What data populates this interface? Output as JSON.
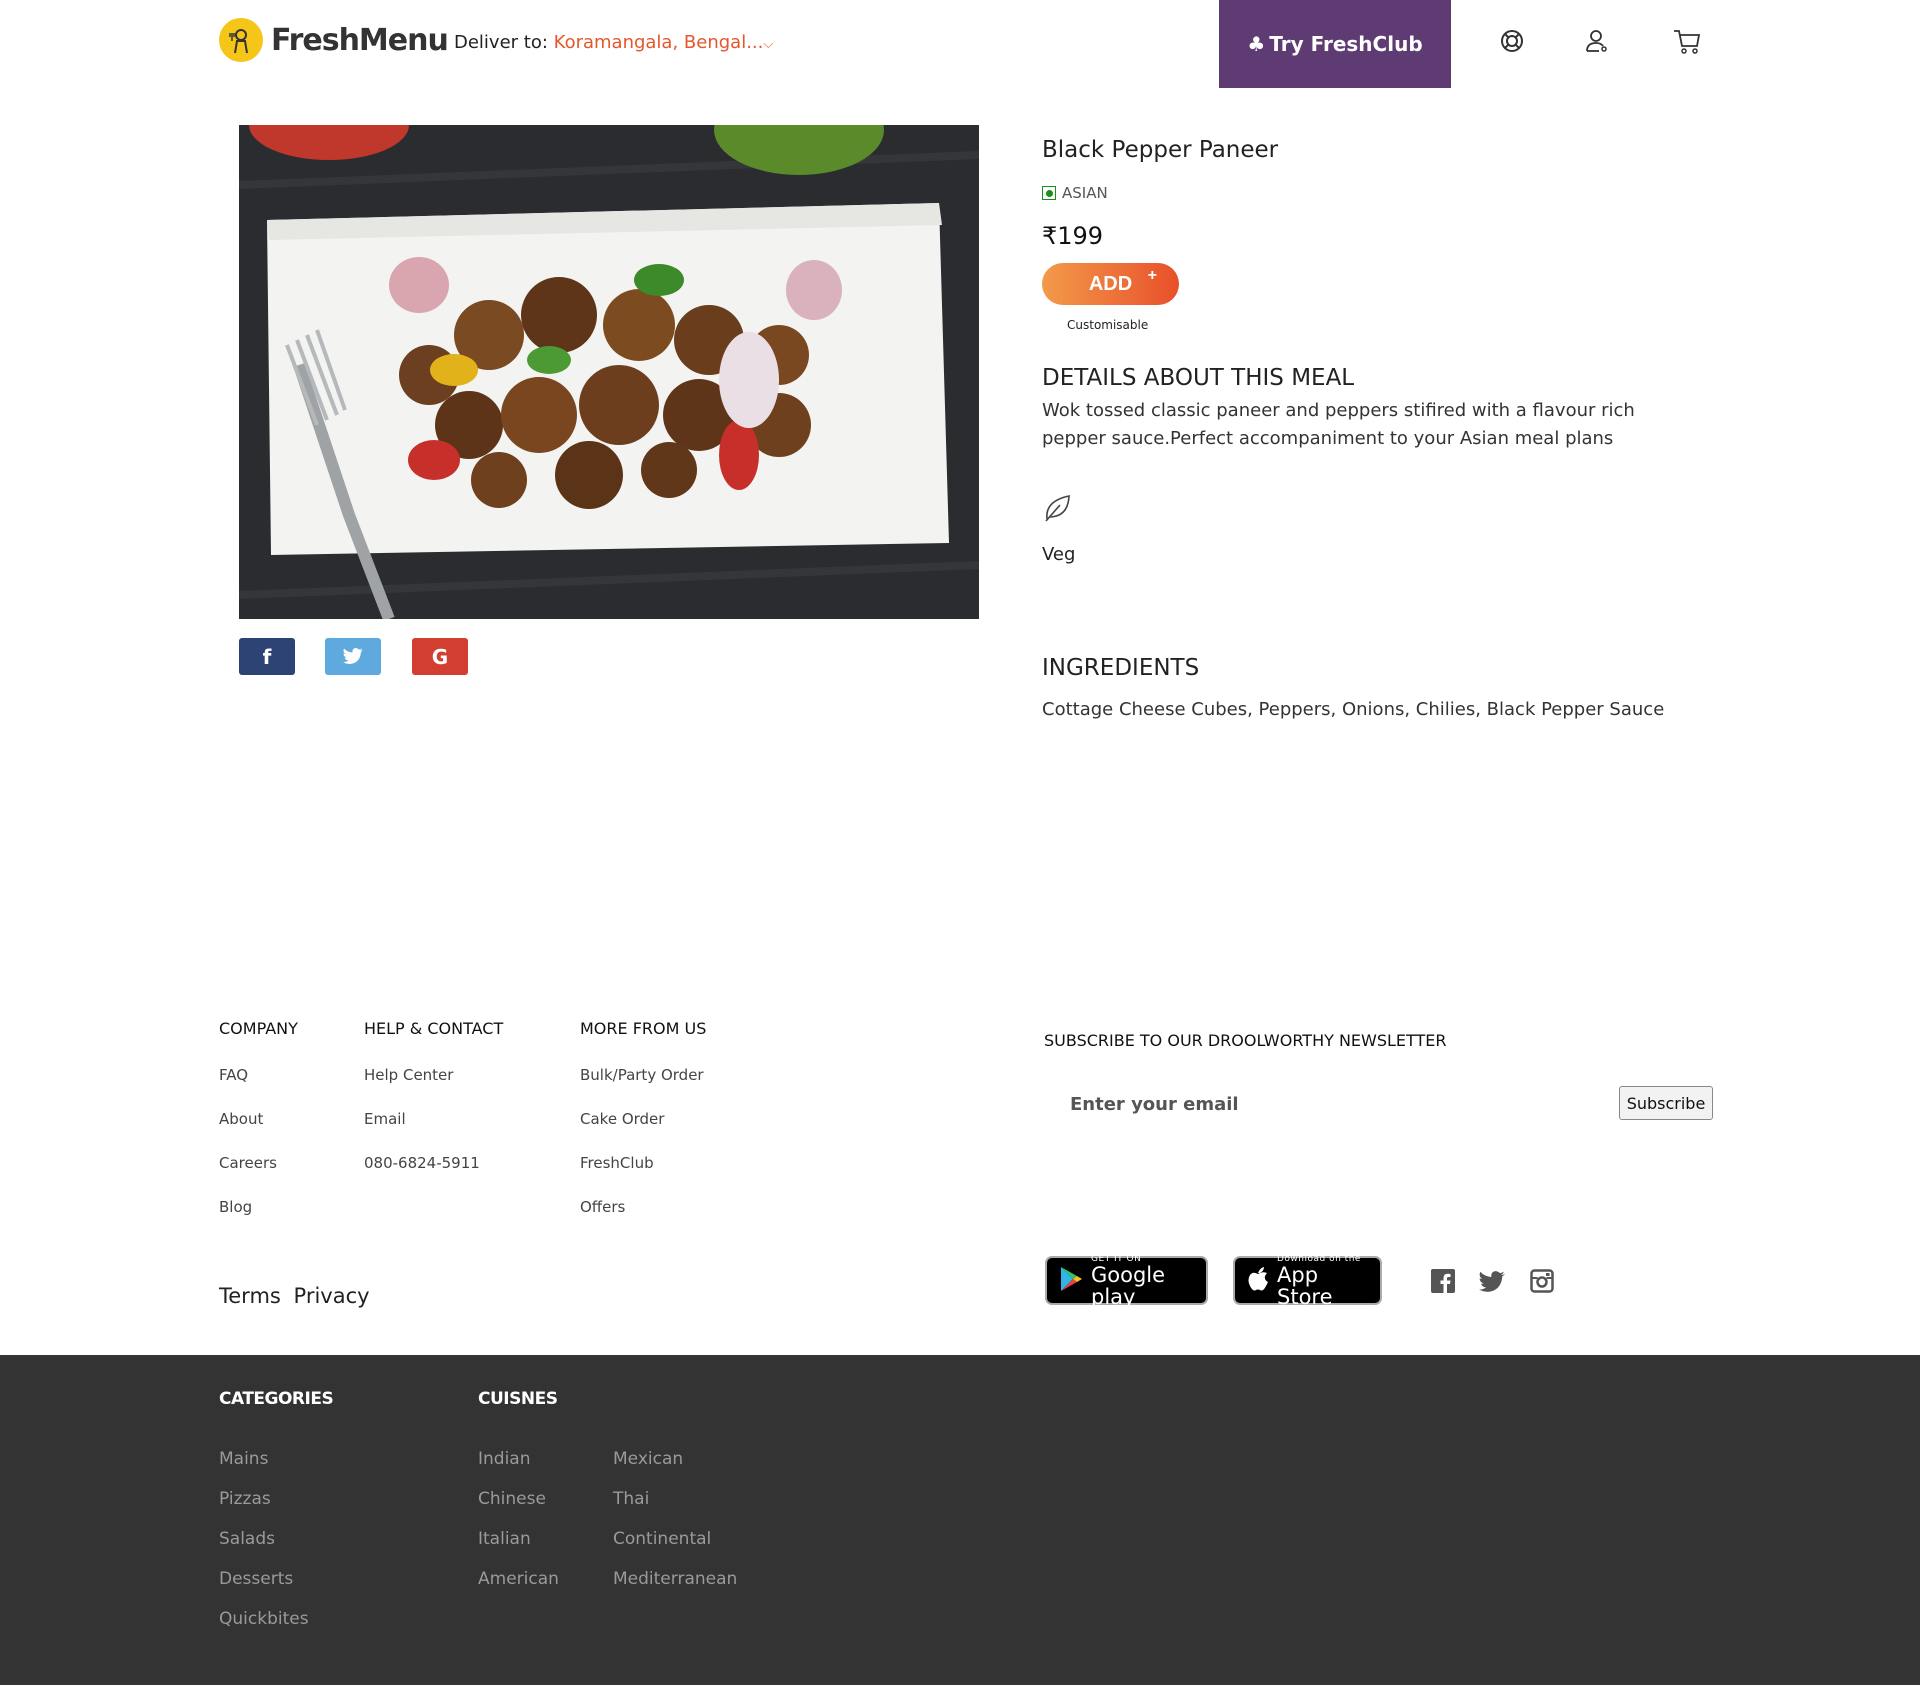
{
  "header": {
    "logo_text": "FreshMenu",
    "deliver_label": "Deliver to:",
    "deliver_location": "Koramangala, Bengal...",
    "freshclub_label": "Try FreshClub",
    "brand_color": "#5e3b72",
    "accent_color": "#e5562a"
  },
  "product": {
    "title": "Black Pepper Paneer",
    "cuisine": "ASIAN",
    "price": "₹199",
    "add_label": "ADD",
    "add_plus": "+",
    "customisable": "Customisable",
    "details_heading": "DETAILS ABOUT THIS MEAL",
    "details_text": "Wok tossed classic paneer and peppers stifired with a flavour rich pepper sauce.Perfect accompaniment to your Asian meal plans",
    "veg_label": "Veg",
    "ingredients_heading": "INGREDIENTS",
    "ingredients_text": "Cottage Cheese Cubes, Peppers, Onions, Chilies, Black Pepper Sauce",
    "share": [
      {
        "icon": "facebook-icon",
        "glyph": "f",
        "color": "#2d4373"
      },
      {
        "icon": "twitter-icon",
        "glyph": "🐦",
        "color": "#5ea9dd"
      },
      {
        "icon": "google-icon",
        "glyph": "G",
        "color": "#d23f31"
      }
    ]
  },
  "footer": {
    "company": {
      "heading": "COMPANY",
      "links": [
        "FAQ",
        "About",
        "Careers",
        "Blog"
      ]
    },
    "help": {
      "heading": "HELP & CONTACT",
      "links": [
        "Help Center",
        "Email",
        "080-6824-5911"
      ]
    },
    "more": {
      "heading": "MORE FROM US",
      "links": [
        "Bulk/Party Order",
        "Cake Order",
        "FreshClub",
        "Offers"
      ]
    },
    "terms": "Terms",
    "privacy": "Privacy",
    "newsletter": {
      "heading": "SUBSCRIBE TO OUR DROOLWORTHY NEWSLETTER",
      "placeholder": "Enter your email",
      "button": "Subscribe"
    },
    "google_play": {
      "small": "GET IT ON",
      "big": "Google play"
    },
    "app_store": {
      "small": "Download on the",
      "big": "App Store"
    }
  },
  "dark_footer": {
    "categories_heading": "CATEGORIES",
    "categories": [
      "Mains",
      "Pizzas",
      "Salads",
      "Desserts",
      "Quickbites"
    ],
    "cuisines_heading": "CUISNES",
    "cuisines_col1": [
      "Indian",
      "Chinese",
      "Italian",
      "American"
    ],
    "cuisines_col2": [
      "Mexican",
      "Thai",
      "Continental",
      "Mediterranean"
    ]
  }
}
